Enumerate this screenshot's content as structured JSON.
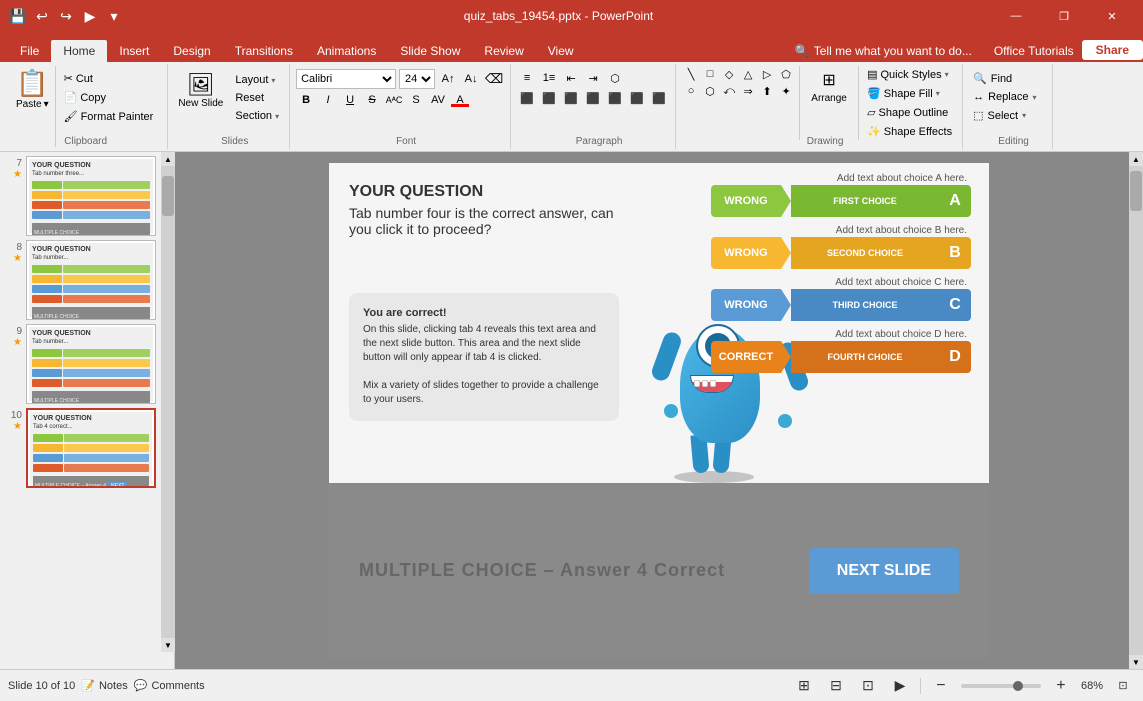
{
  "titlebar": {
    "filename": "quiz_tabs_19454.pptx - PowerPoint",
    "controls": [
      "minimize",
      "restore",
      "close"
    ]
  },
  "ribbon_tabs": {
    "tabs": [
      "File",
      "Home",
      "Insert",
      "Design",
      "Transitions",
      "Animations",
      "Slide Show",
      "Review",
      "View"
    ],
    "active": "Home",
    "help_label": "Tell me what you want to do...",
    "tutorials_label": "Office Tutorials",
    "share_label": "Share"
  },
  "ribbon": {
    "groups": {
      "clipboard": "Clipboard",
      "slides": "Slides",
      "font": "Font",
      "paragraph": "Paragraph",
      "drawing": "Drawing",
      "editing": "Editing"
    },
    "buttons": {
      "paste": "Paste",
      "cut": "Cut",
      "copy": "Copy",
      "format_painter": "Format Painter",
      "new_slide": "New Slide",
      "layout": "Layout",
      "reset": "Reset",
      "section": "Section",
      "shape_fill": "Shape Fill",
      "shape_outline": "Shape Outline",
      "shape_effects": "Shape Effects",
      "arrange": "Arrange",
      "quick_styles": "Quick Styles",
      "find": "Find",
      "replace": "Replace",
      "select": "Select"
    }
  },
  "slides": {
    "total": 10,
    "current": 10,
    "items": [
      {
        "num": "7",
        "star": true
      },
      {
        "num": "8",
        "star": true
      },
      {
        "num": "9",
        "star": true
      },
      {
        "num": "10",
        "star": true,
        "active": true
      }
    ]
  },
  "slide_content": {
    "question_title": "YOUR QUESTION",
    "question_text": "Tab number four is the correct answer, can you click it to proceed?",
    "explain_title": "You are correct!",
    "explain_body": "On this slide, clicking tab 4 reveals this text area and the next slide button. This area and the next slide button will only appear if tab 4 is clicked.\n\nMix a variety of slides together to provide a challenge to your users.",
    "choices": [
      {
        "label": "Add text about choice A here.",
        "status": "WRONG",
        "name": "FIRST CHOICE",
        "letter": "A",
        "type": "green"
      },
      {
        "label": "Add text about choice B here.",
        "status": "WRONG",
        "name": "SECOND CHOICE",
        "letter": "B",
        "type": "yellow"
      },
      {
        "label": "Add text about choice C here.",
        "status": "WRONG",
        "name": "THIRD CHOICE",
        "letter": "C",
        "type": "blue"
      },
      {
        "label": "Add text about choice D here.",
        "status": "CORRECT",
        "name": "FOURTH CHOICE",
        "letter": "D",
        "type": "orange"
      }
    ],
    "bottom_text": "MULTIPLE CHOICE – Answer 4 Correct",
    "next_btn": "NEXT SLIDE"
  },
  "statusbar": {
    "slide_info": "Slide 10 of 10",
    "notes_label": "Notes",
    "comments_label": "Comments",
    "zoom_percent": "68%"
  }
}
